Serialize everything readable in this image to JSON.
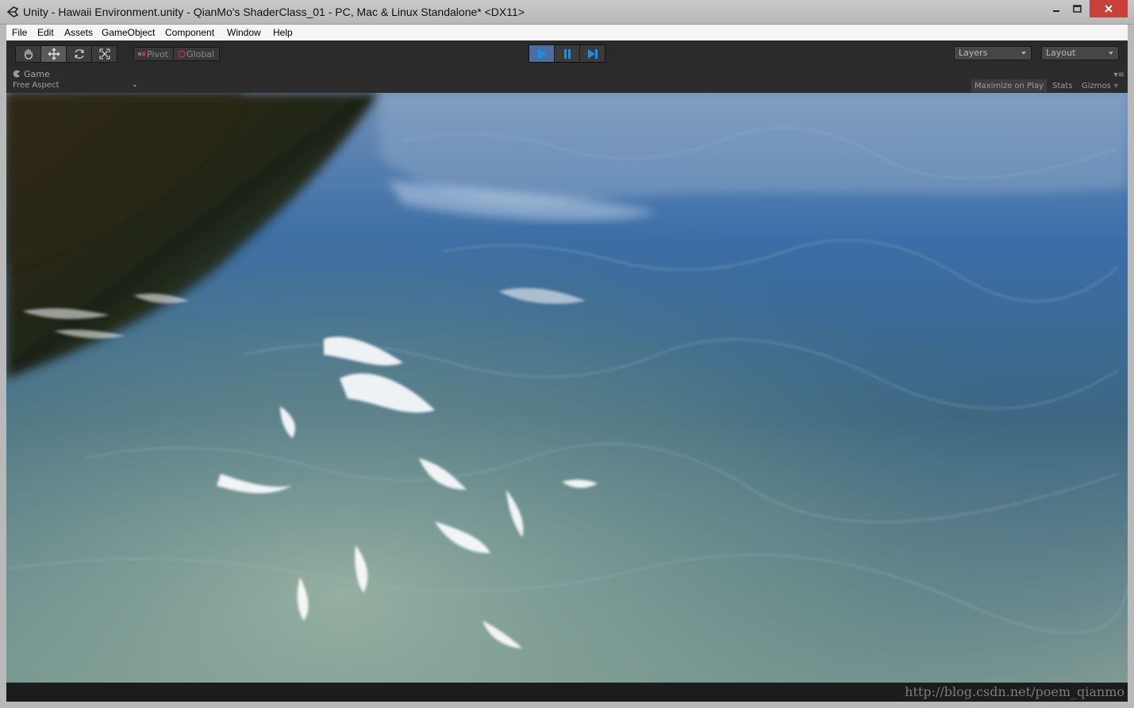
{
  "window": {
    "title": "Unity - Hawaii Environment.unity - QianMo's ShaderClass_01 - PC, Mac & Linux Standalone* <DX11>"
  },
  "menu": [
    {
      "label": "File"
    },
    {
      "label": "Edit"
    },
    {
      "label": "Assets"
    },
    {
      "label": "GameObject"
    },
    {
      "label": "Component"
    },
    {
      "label": "Window"
    },
    {
      "label": "Help"
    }
  ],
  "toolbar": {
    "tools": [
      "hand-icon",
      "move-icon",
      "rotate-icon",
      "scale-icon"
    ],
    "active_tool": "move-icon",
    "pivot_label": "Pivot",
    "global_label": "Global",
    "layers_label": "Layers",
    "layout_label": "Layout",
    "play_state": "playing"
  },
  "game_view": {
    "tab_label": "Game",
    "aspect_label": "Free Aspect",
    "maximize_label": "Maximize on Play",
    "stats_label": "Stats",
    "gizmos_label": "Gizmos"
  },
  "watermark": "http://blog.csdn.net/poem_qianmo",
  "colors": {
    "play_accent": "#4a6ea0",
    "close_button": "#c7413b"
  }
}
